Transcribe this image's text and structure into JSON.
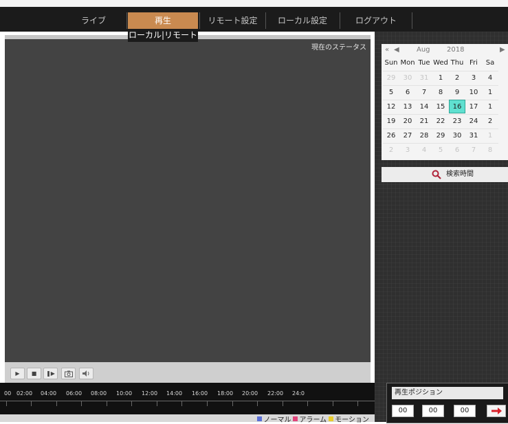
{
  "nav": {
    "items": [
      "ライブ",
      "再生",
      "リモート設定",
      "ローカル設定",
      "ログアウト"
    ],
    "submenu": "ローカル|リモート"
  },
  "video": {
    "status": "現在のステータス"
  },
  "timeline": {
    "labels": [
      "00",
      "02:00",
      "04:00",
      "06:00",
      "08:00",
      "10:00",
      "12:00",
      "14:00",
      "16:00",
      "18:00",
      "20:00",
      "22:00",
      "24:0"
    ]
  },
  "legend": {
    "normal": "ノーマル",
    "alarm": "アラーム",
    "motion": "モーション",
    "colors": {
      "normal": "#5a6fd6",
      "alarm": "#e0447a",
      "motion": "#e8cc2a"
    }
  },
  "calendar": {
    "month": "Aug",
    "year": "2018",
    "weekdays": [
      "Sun",
      "Mon",
      "Tue",
      "Wed",
      "Thu",
      "Fri",
      "Sa"
    ],
    "rows": [
      [
        "29",
        "30",
        "31",
        "1",
        "2",
        "3",
        "4"
      ],
      [
        "5",
        "6",
        "7",
        "8",
        "9",
        "10",
        "1"
      ],
      [
        "12",
        "13",
        "14",
        "15",
        "16",
        "17",
        "1"
      ],
      [
        "19",
        "20",
        "21",
        "22",
        "23",
        "24",
        "2"
      ],
      [
        "26",
        "27",
        "28",
        "29",
        "30",
        "31",
        "1"
      ],
      [
        "2",
        "3",
        "4",
        "5",
        "6",
        "7",
        "8"
      ]
    ],
    "selected": "16",
    "today_color": "#5fe0d0"
  },
  "search": {
    "label": "検索時間"
  },
  "position": {
    "label": "再生ポジション",
    "hours": "00",
    "minutes": "00",
    "seconds": "00"
  }
}
